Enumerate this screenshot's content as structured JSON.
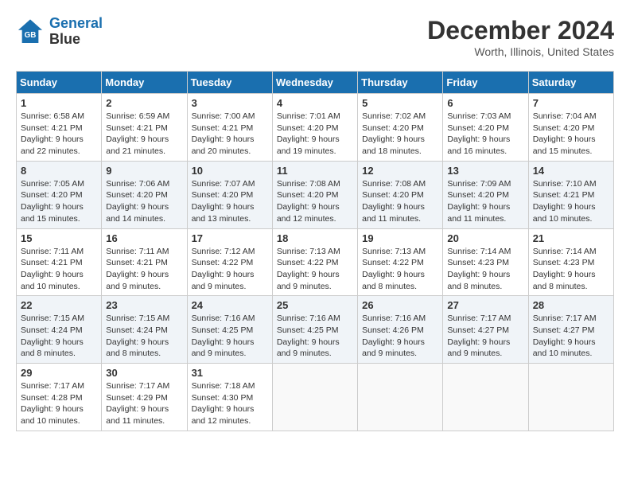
{
  "header": {
    "logo_line1": "General",
    "logo_line2": "Blue",
    "title": "December 2024",
    "subtitle": "Worth, Illinois, United States"
  },
  "days_of_week": [
    "Sunday",
    "Monday",
    "Tuesday",
    "Wednesday",
    "Thursday",
    "Friday",
    "Saturday"
  ],
  "weeks": [
    [
      {
        "day": "1",
        "sunrise": "6:58 AM",
        "sunset": "4:21 PM",
        "daylight": "9 hours and 22 minutes."
      },
      {
        "day": "2",
        "sunrise": "6:59 AM",
        "sunset": "4:21 PM",
        "daylight": "9 hours and 21 minutes."
      },
      {
        "day": "3",
        "sunrise": "7:00 AM",
        "sunset": "4:21 PM",
        "daylight": "9 hours and 20 minutes."
      },
      {
        "day": "4",
        "sunrise": "7:01 AM",
        "sunset": "4:20 PM",
        "daylight": "9 hours and 19 minutes."
      },
      {
        "day": "5",
        "sunrise": "7:02 AM",
        "sunset": "4:20 PM",
        "daylight": "9 hours and 18 minutes."
      },
      {
        "day": "6",
        "sunrise": "7:03 AM",
        "sunset": "4:20 PM",
        "daylight": "9 hours and 16 minutes."
      },
      {
        "day": "7",
        "sunrise": "7:04 AM",
        "sunset": "4:20 PM",
        "daylight": "9 hours and 15 minutes."
      }
    ],
    [
      {
        "day": "8",
        "sunrise": "7:05 AM",
        "sunset": "4:20 PM",
        "daylight": "9 hours and 15 minutes."
      },
      {
        "day": "9",
        "sunrise": "7:06 AM",
        "sunset": "4:20 PM",
        "daylight": "9 hours and 14 minutes."
      },
      {
        "day": "10",
        "sunrise": "7:07 AM",
        "sunset": "4:20 PM",
        "daylight": "9 hours and 13 minutes."
      },
      {
        "day": "11",
        "sunrise": "7:08 AM",
        "sunset": "4:20 PM",
        "daylight": "9 hours and 12 minutes."
      },
      {
        "day": "12",
        "sunrise": "7:08 AM",
        "sunset": "4:20 PM",
        "daylight": "9 hours and 11 minutes."
      },
      {
        "day": "13",
        "sunrise": "7:09 AM",
        "sunset": "4:20 PM",
        "daylight": "9 hours and 11 minutes."
      },
      {
        "day": "14",
        "sunrise": "7:10 AM",
        "sunset": "4:21 PM",
        "daylight": "9 hours and 10 minutes."
      }
    ],
    [
      {
        "day": "15",
        "sunrise": "7:11 AM",
        "sunset": "4:21 PM",
        "daylight": "9 hours and 10 minutes."
      },
      {
        "day": "16",
        "sunrise": "7:11 AM",
        "sunset": "4:21 PM",
        "daylight": "9 hours and 9 minutes."
      },
      {
        "day": "17",
        "sunrise": "7:12 AM",
        "sunset": "4:22 PM",
        "daylight": "9 hours and 9 minutes."
      },
      {
        "day": "18",
        "sunrise": "7:13 AM",
        "sunset": "4:22 PM",
        "daylight": "9 hours and 9 minutes."
      },
      {
        "day": "19",
        "sunrise": "7:13 AM",
        "sunset": "4:22 PM",
        "daylight": "9 hours and 8 minutes."
      },
      {
        "day": "20",
        "sunrise": "7:14 AM",
        "sunset": "4:23 PM",
        "daylight": "9 hours and 8 minutes."
      },
      {
        "day": "21",
        "sunrise": "7:14 AM",
        "sunset": "4:23 PM",
        "daylight": "9 hours and 8 minutes."
      }
    ],
    [
      {
        "day": "22",
        "sunrise": "7:15 AM",
        "sunset": "4:24 PM",
        "daylight": "9 hours and 8 minutes."
      },
      {
        "day": "23",
        "sunrise": "7:15 AM",
        "sunset": "4:24 PM",
        "daylight": "9 hours and 8 minutes."
      },
      {
        "day": "24",
        "sunrise": "7:16 AM",
        "sunset": "4:25 PM",
        "daylight": "9 hours and 9 minutes."
      },
      {
        "day": "25",
        "sunrise": "7:16 AM",
        "sunset": "4:25 PM",
        "daylight": "9 hours and 9 minutes."
      },
      {
        "day": "26",
        "sunrise": "7:16 AM",
        "sunset": "4:26 PM",
        "daylight": "9 hours and 9 minutes."
      },
      {
        "day": "27",
        "sunrise": "7:17 AM",
        "sunset": "4:27 PM",
        "daylight": "9 hours and 9 minutes."
      },
      {
        "day": "28",
        "sunrise": "7:17 AM",
        "sunset": "4:27 PM",
        "daylight": "9 hours and 10 minutes."
      }
    ],
    [
      {
        "day": "29",
        "sunrise": "7:17 AM",
        "sunset": "4:28 PM",
        "daylight": "9 hours and 10 minutes."
      },
      {
        "day": "30",
        "sunrise": "7:17 AM",
        "sunset": "4:29 PM",
        "daylight": "9 hours and 11 minutes."
      },
      {
        "day": "31",
        "sunrise": "7:18 AM",
        "sunset": "4:30 PM",
        "daylight": "9 hours and 12 minutes."
      },
      null,
      null,
      null,
      null
    ]
  ],
  "labels": {
    "sunrise": "Sunrise:",
    "sunset": "Sunset:",
    "daylight": "Daylight:"
  }
}
